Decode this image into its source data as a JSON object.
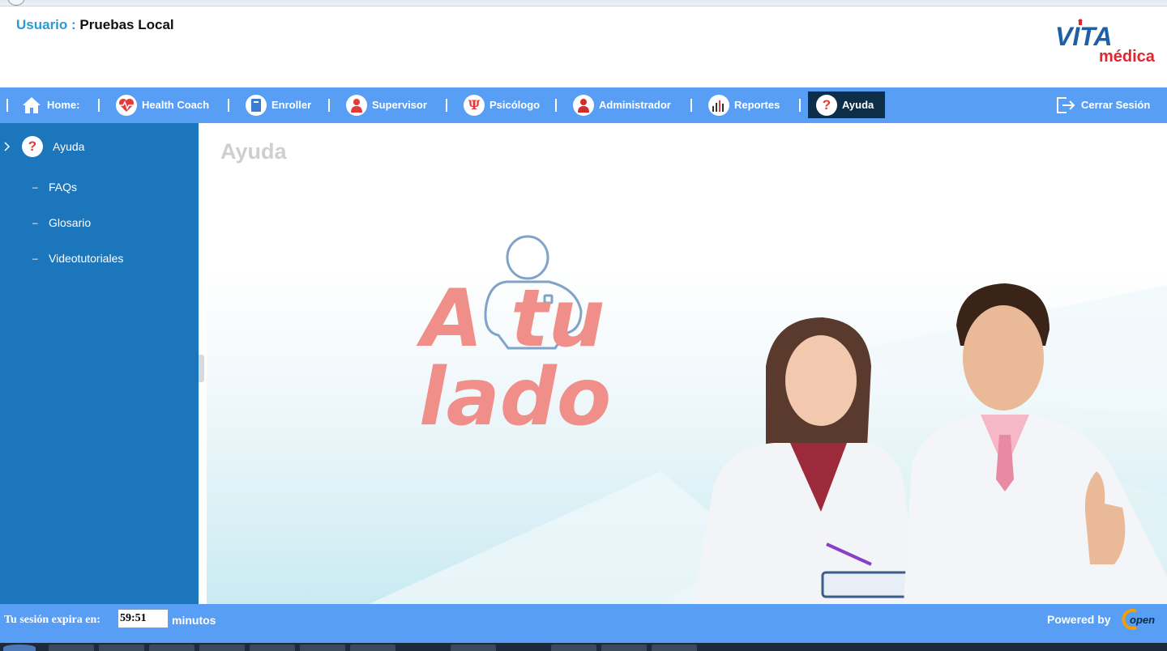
{
  "header": {
    "user_label": "Usuario :",
    "user_name": "Pruebas Local",
    "logo_word1": "VITA",
    "logo_word2": "médica"
  },
  "nav": {
    "items": [
      {
        "label": "Home:",
        "icon": "home-icon"
      },
      {
        "label": "Health Coach",
        "icon": "heart-pulse-icon"
      },
      {
        "label": "Enroller",
        "icon": "book-icon"
      },
      {
        "label": "Supervisor",
        "icon": "person-icon"
      },
      {
        "label": "Psicólogo",
        "icon": "psi-icon"
      },
      {
        "label": "Administrador",
        "icon": "admin-icon"
      },
      {
        "label": "Reportes",
        "icon": "bar-chart-icon"
      },
      {
        "label": "Ayuda",
        "icon": "help-icon",
        "active": true
      }
    ],
    "logout_label": "Cerrar Sesión"
  },
  "sidebar": {
    "header_label": "Ayuda",
    "items": [
      {
        "label": "FAQs"
      },
      {
        "label": "Glosario"
      },
      {
        "label": "Videotutoriales"
      }
    ]
  },
  "main": {
    "title": "Ayuda",
    "banner_line1": "A tu",
    "banner_line2": "lado"
  },
  "footer": {
    "session_label": "Tu sesión expira en:",
    "timer_value": "59:51",
    "minutes_label": "minutos",
    "powered_label": "Powered by",
    "open_logo_text": "open"
  },
  "colors": {
    "nav_bg": "#589ef4",
    "sidebar_bg": "#1b76bc",
    "active_tab": "#0c2e49",
    "brand_blue": "#1f5fa8",
    "brand_red": "#e2262f",
    "banner_pink": "#f08f8a",
    "banner_blue": "#7fa4c8"
  }
}
